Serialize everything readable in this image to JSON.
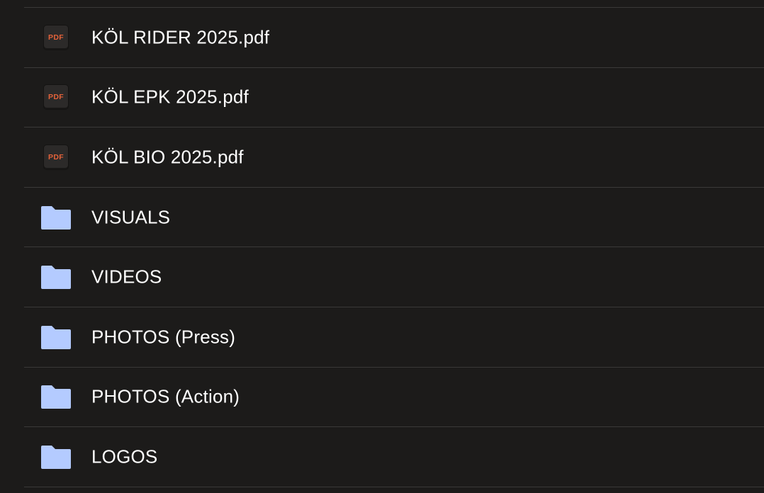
{
  "files": [
    {
      "name": "KÖL RIDER 2025.pdf",
      "type": "pdf",
      "icon": "pdf-file-icon",
      "badge": "PDF"
    },
    {
      "name": "KÖL EPK 2025.pdf",
      "type": "pdf",
      "icon": "pdf-file-icon",
      "badge": "PDF"
    },
    {
      "name": "KÖL BIO 2025.pdf",
      "type": "pdf",
      "icon": "pdf-file-icon",
      "badge": "PDF"
    },
    {
      "name": "VISUALS",
      "type": "folder",
      "icon": "folder-icon"
    },
    {
      "name": "VIDEOS",
      "type": "folder",
      "icon": "folder-icon"
    },
    {
      "name": "PHOTOS (Press)",
      "type": "folder",
      "icon": "folder-icon"
    },
    {
      "name": "PHOTOS (Action)",
      "type": "folder",
      "icon": "folder-icon"
    },
    {
      "name": "LOGOS",
      "type": "folder",
      "icon": "folder-icon"
    }
  ],
  "colors": {
    "background": "#1c1b1a",
    "divider": "#3a3938",
    "text": "#ffffff",
    "pdf_label": "#e4623a",
    "folder": "#b4cbff"
  }
}
